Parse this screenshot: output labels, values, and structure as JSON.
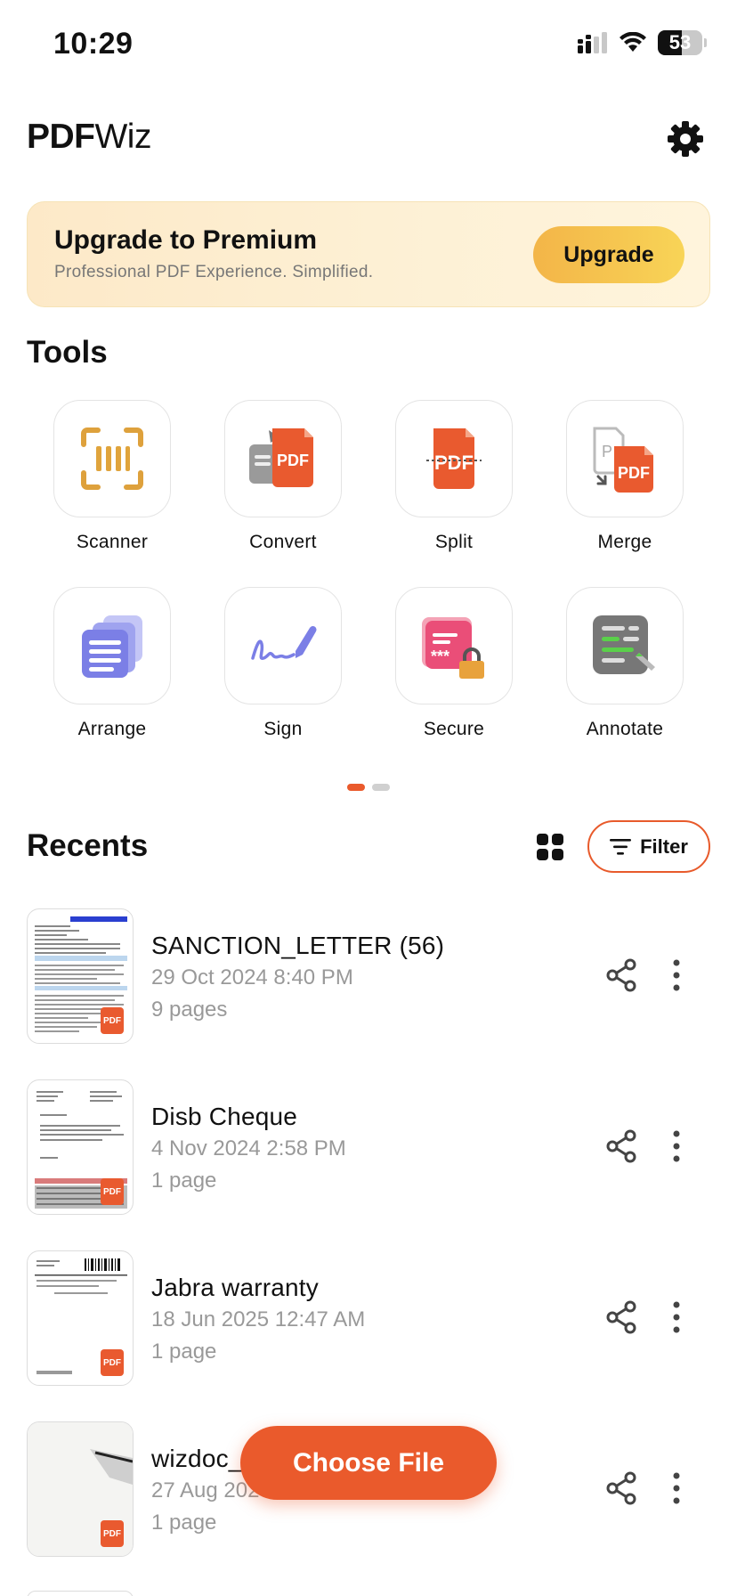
{
  "status_bar": {
    "time": "10:29",
    "battery": "53"
  },
  "header": {
    "title_bold": "PDF",
    "title_normal": "Wiz"
  },
  "banner": {
    "title": "Upgrade to Premium",
    "subtitle": "Professional PDF Experience. Simplified.",
    "button": "Upgrade"
  },
  "tools": {
    "title": "Tools",
    "items": [
      {
        "label": "Scanner",
        "icon": "scanner-icon"
      },
      {
        "label": "Convert",
        "icon": "convert-icon"
      },
      {
        "label": "Split",
        "icon": "split-icon"
      },
      {
        "label": "Merge",
        "icon": "merge-icon"
      },
      {
        "label": "Arrange",
        "icon": "arrange-icon"
      },
      {
        "label": "Sign",
        "icon": "sign-icon"
      },
      {
        "label": "Secure",
        "icon": "secure-icon"
      },
      {
        "label": "Annotate",
        "icon": "annotate-icon"
      }
    ],
    "pages_total": 2,
    "page_active": 1
  },
  "recents": {
    "title": "Recents",
    "filter_label": "Filter",
    "items": [
      {
        "name": "SANCTION_LETTER (56)",
        "date": "29 Oct 2024  8:40 PM",
        "pages": "9 pages"
      },
      {
        "name": "Disb Cheque",
        "date": "4 Nov 2024  2:58 PM",
        "pages": "1 page"
      },
      {
        "name": "Jabra warranty",
        "date": "18 Jun 2025  12:47 AM",
        "pages": "1 page"
      },
      {
        "name": "wizdoc_",
        "date": "27 Aug 202",
        "pages": "1 page"
      }
    ],
    "thumb_badge": "PDF"
  },
  "fab": {
    "label": "Choose File"
  },
  "colors": {
    "accent": "#ea5a2c",
    "upgrade_start": "#f3b548",
    "upgrade_end": "#f8d457"
  }
}
